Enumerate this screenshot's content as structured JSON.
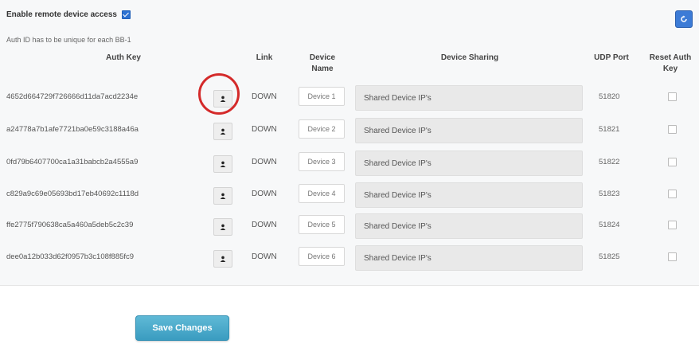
{
  "enable_label": "Enable remote device access",
  "enable_checked": true,
  "note": "Auth ID has to be unique for each BB-1",
  "headers": {
    "auth_key": "Auth Key",
    "link": "Link",
    "device_name_line1": "Device",
    "device_name_line2": "Name",
    "device_sharing": "Device Sharing",
    "udp_port": "UDP Port",
    "reset_line1": "Reset Auth",
    "reset_line2": "Key"
  },
  "rows": [
    {
      "auth_key": "4652d664729f726666d11da7acd2234e",
      "link": "DOWN",
      "device_name": "Device 1",
      "sharing": "Shared Device IP's",
      "udp_port": "51820"
    },
    {
      "auth_key": "a24778a7b1afe7721ba0e59c3188a46a",
      "link": "DOWN",
      "device_name": "Device 2",
      "sharing": "Shared Device IP's",
      "udp_port": "51821"
    },
    {
      "auth_key": "0fd79b6407700ca1a31babcb2a4555a9",
      "link": "DOWN",
      "device_name": "Device 3",
      "sharing": "Shared Device IP's",
      "udp_port": "51822"
    },
    {
      "auth_key": "c829a9c69e05693bd17eb40692c1118d",
      "link": "DOWN",
      "device_name": "Device 4",
      "sharing": "Shared Device IP's",
      "udp_port": "51823"
    },
    {
      "auth_key": "ffe2775f790638ca5a460a5deb5c2c39",
      "link": "DOWN",
      "device_name": "Device 5",
      "sharing": "Shared Device IP's",
      "udp_port": "51824"
    },
    {
      "auth_key": "dee0a12b033d62f0957b3c108f885fc9",
      "link": "DOWN",
      "device_name": "Device 6",
      "sharing": "Shared Device IP's",
      "udp_port": "51825"
    }
  ],
  "save_label": "Save Changes",
  "icons": {
    "refresh": "refresh-icon",
    "link_button": "user-icon"
  },
  "colors": {
    "checkbox_blue": "#2d72d2",
    "refresh_blue": "#3c7bd6",
    "save_button": "#4aabcb",
    "highlight_red": "#d42a2a"
  }
}
